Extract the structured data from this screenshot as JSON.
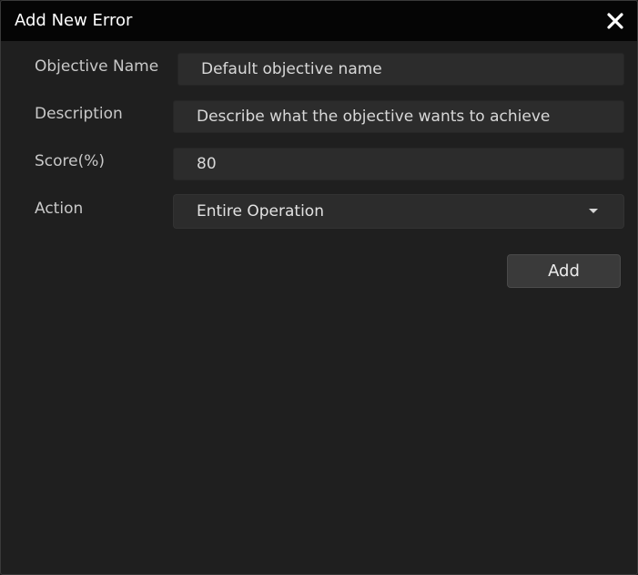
{
  "dialog": {
    "title": "Add New Error",
    "close_icon": "close-icon"
  },
  "form": {
    "objective_name": {
      "label": "Objective Name",
      "value": "Default objective name"
    },
    "description": {
      "label": "Description",
      "value": "Describe what the objective wants to achieve"
    },
    "score": {
      "label": "Score(%)",
      "value": "80"
    },
    "action": {
      "label": "Action",
      "selected": "Entire Operation",
      "icon": "chevron-down-icon"
    }
  },
  "buttons": {
    "add_label": "Add"
  },
  "colors": {
    "title_bar": "#050505",
    "background": "#1f1f1f",
    "input_bg": "#2c2c2c",
    "button_bg": "#3a3a3a"
  }
}
